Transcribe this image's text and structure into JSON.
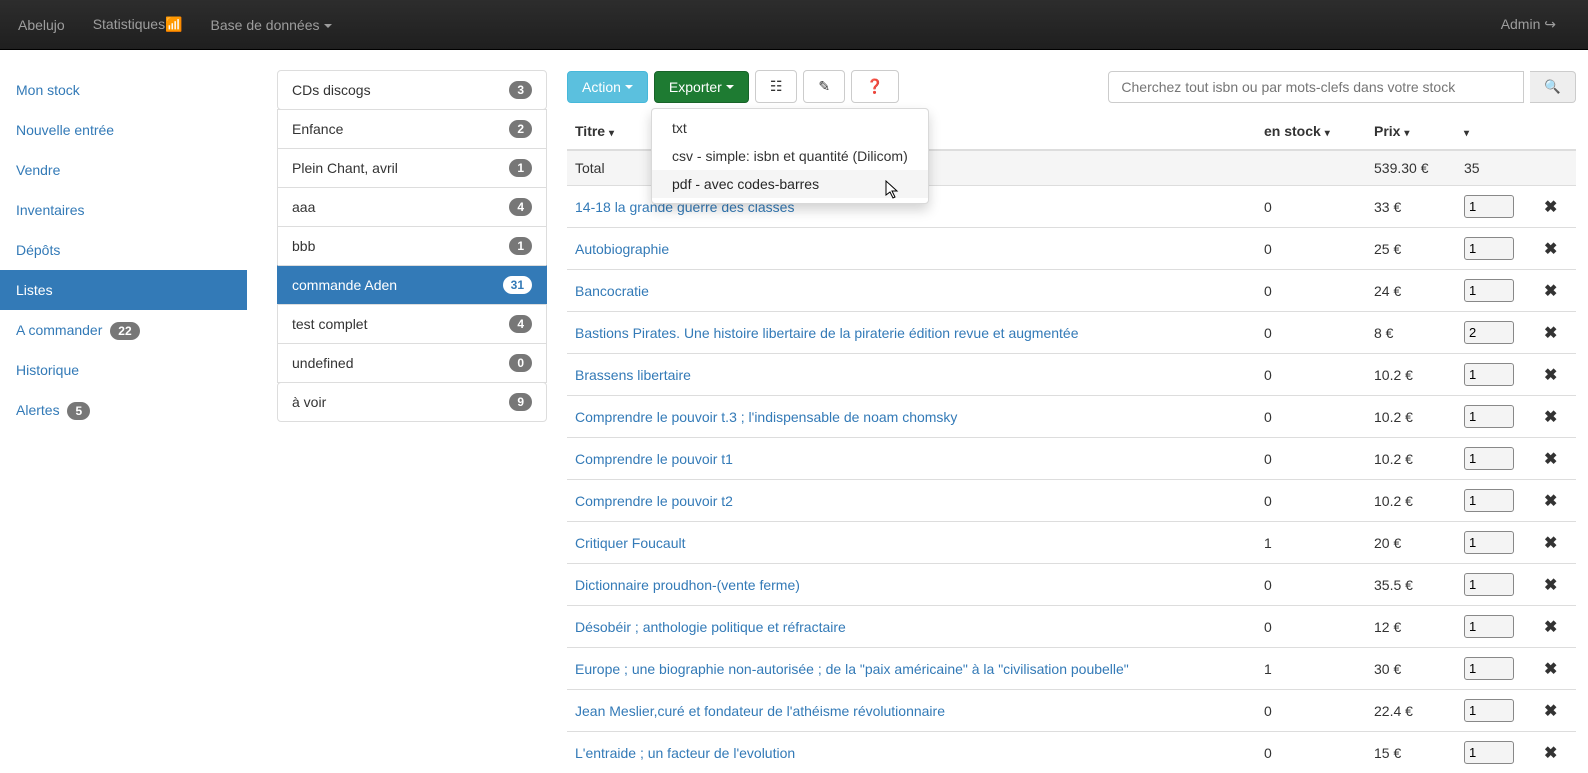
{
  "nav": {
    "brand": "Abelujo",
    "stats": "Statistiques",
    "db": "Base de données",
    "admin": "Admin"
  },
  "sidebar": {
    "items": [
      {
        "label": "Mon stock"
      },
      {
        "label": "Nouvelle entrée"
      },
      {
        "label": "Vendre"
      },
      {
        "label": "Inventaires"
      },
      {
        "label": "Dépôts"
      },
      {
        "label": "Listes",
        "active": true
      },
      {
        "label": "A commander",
        "badge": "22"
      },
      {
        "label": "Historique"
      },
      {
        "label": "Alertes",
        "badge": "5"
      }
    ]
  },
  "lists": [
    {
      "label": "CDs discogs",
      "badge": "3"
    },
    {
      "label": "Enfance",
      "badge": "2"
    },
    {
      "label": "Plein Chant, avril",
      "badge": "1"
    },
    {
      "label": "aaa",
      "badge": "4"
    },
    {
      "label": "bbb",
      "badge": "1"
    },
    {
      "label": "commande Aden",
      "badge": "31",
      "active": true
    },
    {
      "label": "test complet",
      "badge": "4"
    },
    {
      "label": "undefined",
      "badge": "0"
    },
    {
      "label": "à voir",
      "badge": "9"
    }
  ],
  "toolbar": {
    "action": "Action",
    "export": "Exporter",
    "search_placeholder": "Cherchez tout isbn ou par mots-clefs dans votre stock"
  },
  "dropdown": {
    "txt": "txt",
    "csv": "csv - simple: isbn et quantité (Dilicom)",
    "pdf": "pdf - avec codes-barres"
  },
  "table": {
    "headers": {
      "title": "Titre",
      "stock": "en stock",
      "price": "Prix"
    },
    "total_label": "Total",
    "total_price": "539.30 €",
    "total_qty": "35",
    "rows": [
      {
        "title": "14-18 la grande guerre des classes",
        "stock": "0",
        "price": "33 €",
        "qty": "1"
      },
      {
        "title": "Autobiographie",
        "stock": "0",
        "price": "25 €",
        "qty": "1"
      },
      {
        "title": "Bancocratie",
        "stock": "0",
        "price": "24 €",
        "qty": "1"
      },
      {
        "title": "Bastions Pirates. Une histoire libertaire de la piraterie édition revue et augmentée",
        "stock": "0",
        "price": "8 €",
        "qty": "2"
      },
      {
        "title": "Brassens libertaire",
        "stock": "0",
        "price": "10.2 €",
        "qty": "1"
      },
      {
        "title": "Comprendre le pouvoir t.3 ; l'indispensable de noam chomsky",
        "stock": "0",
        "price": "10.2 €",
        "qty": "1"
      },
      {
        "title": "Comprendre le pouvoir t1",
        "stock": "0",
        "price": "10.2 €",
        "qty": "1"
      },
      {
        "title": "Comprendre le pouvoir t2",
        "stock": "0",
        "price": "10.2 €",
        "qty": "1"
      },
      {
        "title": "Critiquer Foucault",
        "stock": "1",
        "price": "20 €",
        "qty": "1"
      },
      {
        "title": "Dictionnaire proudhon-(vente ferme)",
        "stock": "0",
        "price": "35.5 €",
        "qty": "1"
      },
      {
        "title": "Désobéir ; anthologie politique et réfractaire",
        "stock": "0",
        "price": "12 €",
        "qty": "1"
      },
      {
        "title": "Europe ; une biographie non-autorisée ; de la \"paix américaine\" à la \"civilisation poubelle\"",
        "stock": "1",
        "price": "30 €",
        "qty": "1"
      },
      {
        "title": "Jean Meslier,curé et fondateur de l'athéisme révolutionnaire",
        "stock": "0",
        "price": "22.4 €",
        "qty": "1"
      },
      {
        "title": "L'entraide ; un facteur de l'evolution",
        "stock": "0",
        "price": "15 €",
        "qty": "1"
      }
    ]
  }
}
